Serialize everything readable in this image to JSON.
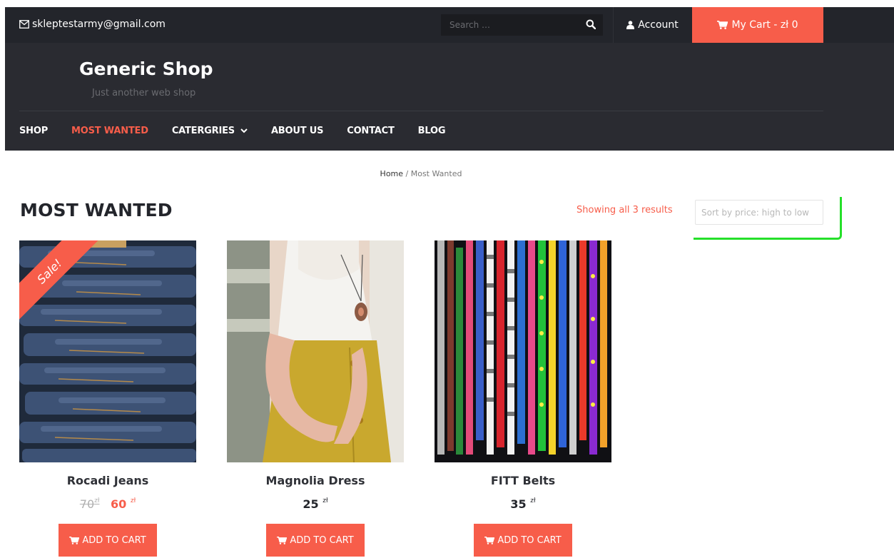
{
  "topbar": {
    "email": "skleptestarmy@gmail.com",
    "search_placeholder": "Search …",
    "account_label": "Account",
    "cart_label": "My Cart - zł 0"
  },
  "header": {
    "site_title": "Generic Shop",
    "tagline": "Just another web shop"
  },
  "nav": {
    "items": [
      {
        "label": "SHOP",
        "active": false
      },
      {
        "label": "MOST WANTED",
        "active": true
      },
      {
        "label": "CATERGRIES",
        "active": false,
        "dropdown": true
      },
      {
        "label": "ABOUT US",
        "active": false
      },
      {
        "label": "CONTACT",
        "active": false
      },
      {
        "label": "BLOG",
        "active": false
      }
    ]
  },
  "breadcrumb": {
    "home": "Home",
    "separator": " / ",
    "current": "Most Wanted"
  },
  "page": {
    "title": "MOST WANTED",
    "results_text": "Showing all 3 results",
    "sort_value": "Sort by price: high to low"
  },
  "products": [
    {
      "name": "Rocadi Jeans",
      "old_price": "70",
      "price": "60",
      "currency": "zł",
      "badge": "Sale!",
      "button": "ADD TO CART"
    },
    {
      "name": "Magnolia Dress",
      "price": "25",
      "currency": "zł",
      "button": "ADD TO CART"
    },
    {
      "name": "FITT Belts",
      "price": "35",
      "currency": "zł",
      "button": "ADD TO CART"
    }
  ],
  "colors": {
    "accent": "#f75d4a",
    "topbar_bg": "#23252b",
    "header_bg": "#2a2b31",
    "highlight": "#25e02a"
  },
  "icons": {
    "email": "envelope-icon",
    "search": "search-icon",
    "account": "user-icon",
    "cart": "cart-icon",
    "dropdown": "chevron-down-icon"
  }
}
